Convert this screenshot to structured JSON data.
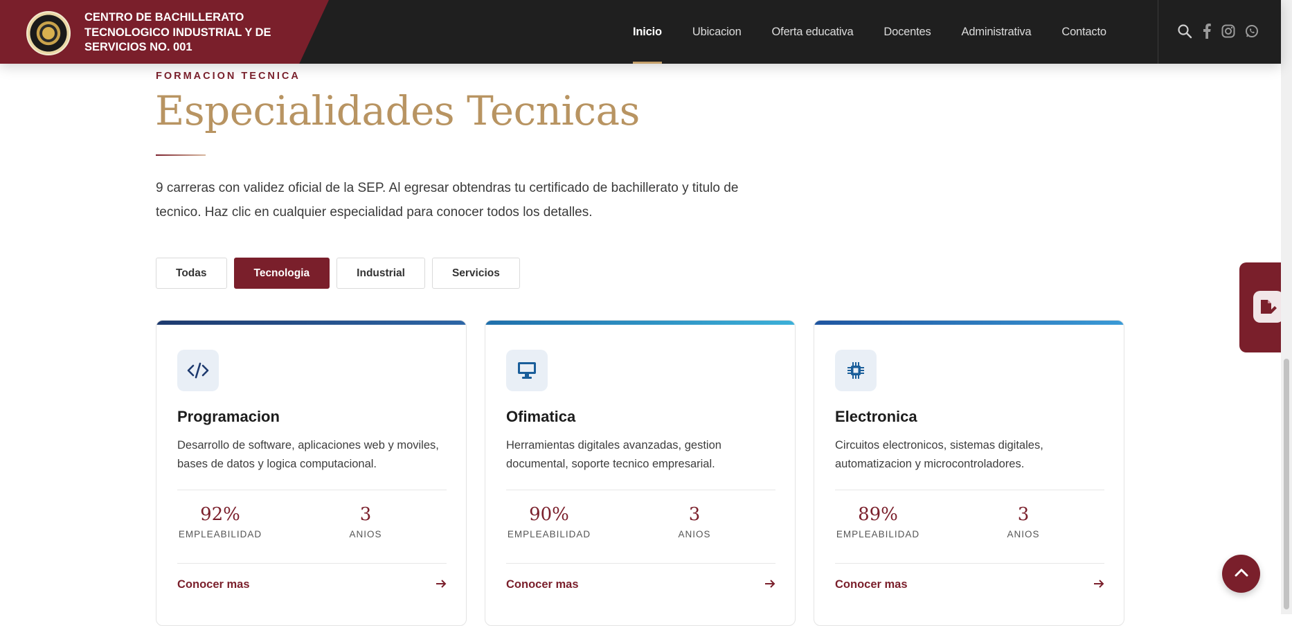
{
  "header": {
    "brand_name": "CENTRO DE BACHILLERATO TECNOLOGICO INDUSTRIAL Y DE SERVICIOS NO. 001",
    "nav": [
      {
        "label": "Inicio",
        "active": true
      },
      {
        "label": "Ubicacion",
        "active": false
      },
      {
        "label": "Oferta educativa",
        "active": false
      },
      {
        "label": "Docentes",
        "active": false
      },
      {
        "label": "Administrativa",
        "active": false
      },
      {
        "label": "Contacto",
        "active": false
      }
    ],
    "icons": [
      "search-icon",
      "facebook-icon",
      "instagram-icon",
      "whatsapp-icon"
    ]
  },
  "section": {
    "eyebrow": "FORMACION TECNICA",
    "title": "Especialidades Tecnicas",
    "intro": "9 carreras con validez oficial de la SEP. Al egresar obtendras tu certificado de bachillerato y titulo de tecnico. Haz clic en cualquier especialidad para conocer todos los detalles."
  },
  "filters": [
    {
      "label": "Todas",
      "active": false
    },
    {
      "label": "Tecnologia",
      "active": true
    },
    {
      "label": "Industrial",
      "active": false
    },
    {
      "label": "Servicios",
      "active": false
    }
  ],
  "cards": [
    {
      "icon": "code-icon",
      "title": "Programacion",
      "description": "Desarrollo de software, aplicaciones web y moviles, bases de datos y logica computacional.",
      "employability_value": "92%",
      "employability_label": "EMPLEABILIDAD",
      "years_value": "3",
      "years_label": "ANIOS",
      "link": "Conocer mas"
    },
    {
      "icon": "monitor-icon",
      "title": "Ofimatica",
      "description": "Herramientas digitales avanzadas, gestion documental, soporte tecnico empresarial.",
      "employability_value": "90%",
      "employability_label": "EMPLEABILIDAD",
      "years_value": "3",
      "years_label": "ANIOS",
      "link": "Conocer mas"
    },
    {
      "icon": "chip-icon",
      "title": "Electronica",
      "description": "Circuitos electronicos, sistemas digitales, automatizacion y microcontroladores.",
      "employability_value": "89%",
      "employability_label": "EMPLEABILIDAD",
      "years_value": "3",
      "years_label": "ANIOS",
      "link": "Conocer mas"
    }
  ],
  "colors": {
    "brand": "#7a1f2b",
    "gold": "#b89462",
    "header_bg": "#1f1f1f",
    "card1_bar": "#1e3a6e",
    "card2_bar": "#2b8fc7",
    "card3_bar": "#2a6fb5"
  },
  "floating": {
    "side_tab_icon": "edit-document-icon",
    "back_to_top_icon": "chevron-up-icon"
  }
}
